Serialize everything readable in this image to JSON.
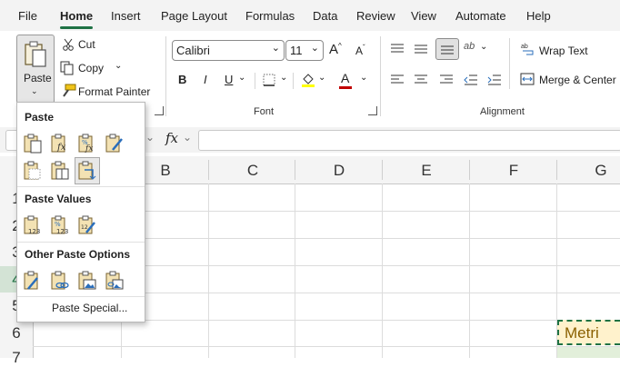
{
  "menu": {
    "items": [
      "File",
      "Home",
      "Insert",
      "Page Layout",
      "Formulas",
      "Data",
      "Review",
      "View",
      "Automate",
      "Help"
    ],
    "active": "Home"
  },
  "clipboard": {
    "paste_label": "Paste",
    "cut_label": "Cut",
    "copy_label": "Copy",
    "format_painter_label": "Format Painter"
  },
  "font": {
    "name": "Calibri",
    "size": "11",
    "group_label": "Font",
    "bold": "B",
    "italic": "I",
    "underline": "U",
    "grow_label": "A",
    "shrink_label": "A",
    "font_color_label": "A",
    "font_color": "#c00000",
    "highlight_color": "#ffff00"
  },
  "alignment": {
    "wrap_text_label": "Wrap Text",
    "merge_center_label": "Merge & Center",
    "group_label": "Alignment",
    "orientation_label": "ab"
  },
  "formula_bar": {
    "fx_label": "fx"
  },
  "columns": [
    "B",
    "C",
    "D",
    "E",
    "F",
    "G"
  ],
  "rows": [
    "1",
    "2",
    "3",
    "4",
    "5",
    "6",
    "7"
  ],
  "cells": {
    "g6_text": "Metri"
  },
  "paste_menu": {
    "section_paste": "Paste",
    "section_values": "Paste Values",
    "section_other": "Other Paste Options",
    "paste_special_label": "Paste Special...",
    "paste_icons": [
      "paste-icon",
      "paste-formulas-icon",
      "paste-formulas-number-format-icon",
      "paste-keep-source-formatting-icon",
      "paste-no-borders-icon",
      "paste-keep-column-widths-icon",
      "paste-transpose-icon"
    ],
    "value_icons": [
      "paste-values-icon",
      "paste-values-number-format-icon",
      "paste-values-source-formatting-icon"
    ],
    "other_icons": [
      "paste-formatting-icon",
      "paste-link-icon",
      "paste-picture-icon",
      "paste-linked-picture-icon"
    ]
  },
  "colors": {
    "accent": "#1f7244",
    "highlight_cell": "#fff2cc",
    "selected_row_header": "#1f7244"
  }
}
